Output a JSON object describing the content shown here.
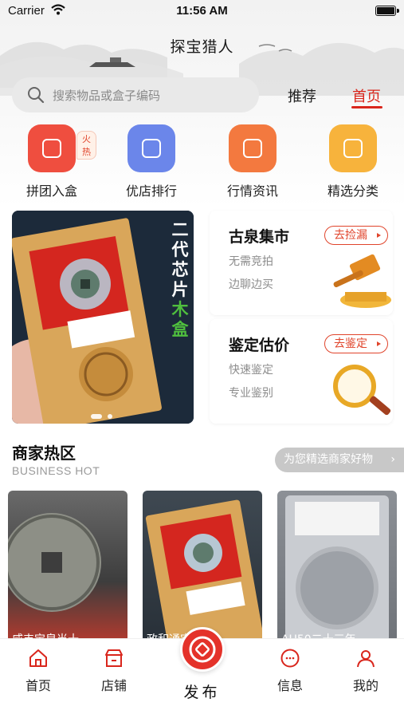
{
  "status_bar": {
    "carrier": "Carrier",
    "time": "11:56 AM"
  },
  "header": {
    "title": "探宝猎人",
    "search_placeholder": "搜索物品或盒子编码",
    "tabs": [
      {
        "label": "推荐"
      },
      {
        "label": "首页",
        "active": true
      }
    ]
  },
  "categories": [
    {
      "label": "拼团入盒",
      "icon": "bag-icon",
      "color": "#ef4e3f",
      "badge": "火热"
    },
    {
      "label": "优店排行",
      "icon": "shop-icon",
      "color": "#6b86ea"
    },
    {
      "label": "行情资讯",
      "icon": "news-icon",
      "color": "#f3793f"
    },
    {
      "label": "精选分类",
      "icon": "search-list-icon",
      "color": "#f7b33c"
    }
  ],
  "banner": {
    "line1": "二代芯片",
    "line2": "木盒"
  },
  "side_cards": [
    {
      "title": "古泉集市",
      "button": "去捡漏",
      "line1": "无需竞拍",
      "line2": "边聊边买"
    },
    {
      "title": "鉴定估价",
      "button": "去鉴定",
      "line1": "快速鉴定",
      "line2": "专业鉴别"
    }
  ],
  "section": {
    "title": "商家热区",
    "subtitle": "BUSINESS HOT",
    "more": "为您精选商家好物"
  },
  "products": [
    {
      "title": "咸丰宝泉当十"
    },
    {
      "title": "政和通宝"
    },
    {
      "title": "AU50二十三年"
    }
  ],
  "tabbar": {
    "items": [
      {
        "label": "首页"
      },
      {
        "label": "店铺"
      },
      {
        "label": "信息"
      },
      {
        "label": "我的"
      }
    ],
    "publish": "发布"
  },
  "colors": {
    "accent": "#d9261c",
    "publish": "#e4322a"
  }
}
